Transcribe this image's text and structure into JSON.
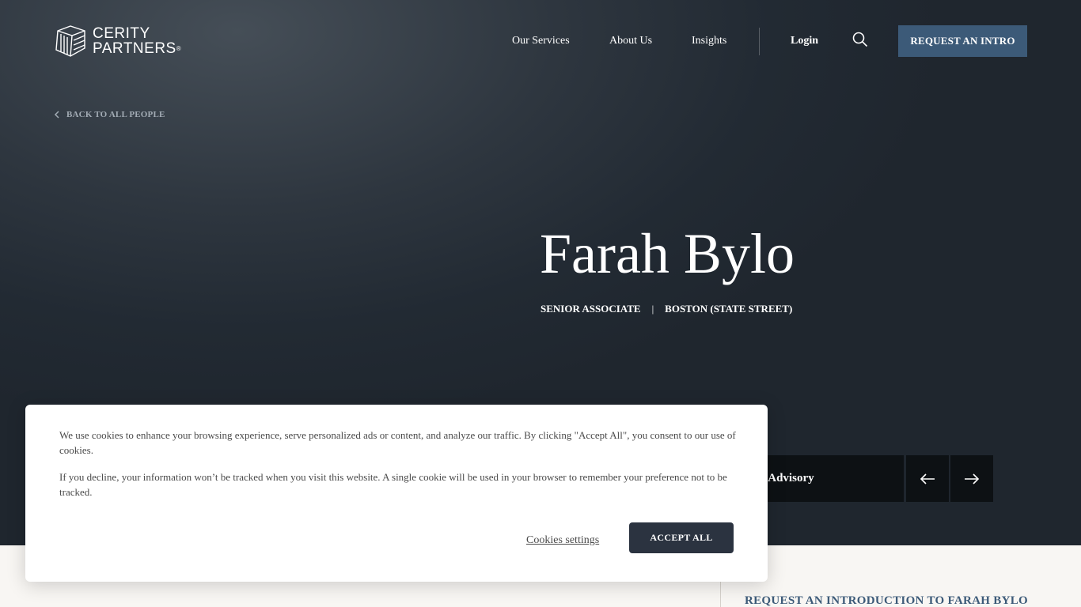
{
  "header": {
    "logo_line1": "CERITY",
    "logo_line2": "PARTNERS",
    "logo_reg": "®",
    "nav": {
      "services": "Our Services",
      "about": "About Us",
      "insights": "Insights",
      "login": "Login"
    },
    "cta": "REQUEST AN INTRO"
  },
  "back_link": "BACK TO ALL PEOPLE",
  "person": {
    "name": "Farah Bylo",
    "title": "SENIOR ASSOCIATE",
    "separator": "|",
    "location": "BOSTON (STATE STREET)"
  },
  "carousel": {
    "tile_label": "nt Advisory"
  },
  "lower": {
    "heading": "REQUEST AN INTRODUCTION TO FARAH BYLO"
  },
  "cookie": {
    "text1": "We use cookies to enhance your browsing experience, serve personalized ads or content, and analyze our traffic. By clicking \"Accept All\", you consent to our use of cookies.",
    "text2": "If you decline, your information won’t be tracked when you visit this website. A single cookie will be used in your browser to remember your preference not to be tracked.",
    "settings_label": "Cookies settings",
    "accept_label": "ACCEPT ALL"
  },
  "colors": {
    "accent": "#3c5a78",
    "hero_bg": "#2e363f",
    "accept_bg": "#2b3340"
  },
  "icons": {
    "logo": "cerity-logo-mark-icon",
    "search": "search-icon",
    "back": "chevron-left-icon",
    "prev": "arrow-left-icon",
    "next": "arrow-right-icon"
  }
}
